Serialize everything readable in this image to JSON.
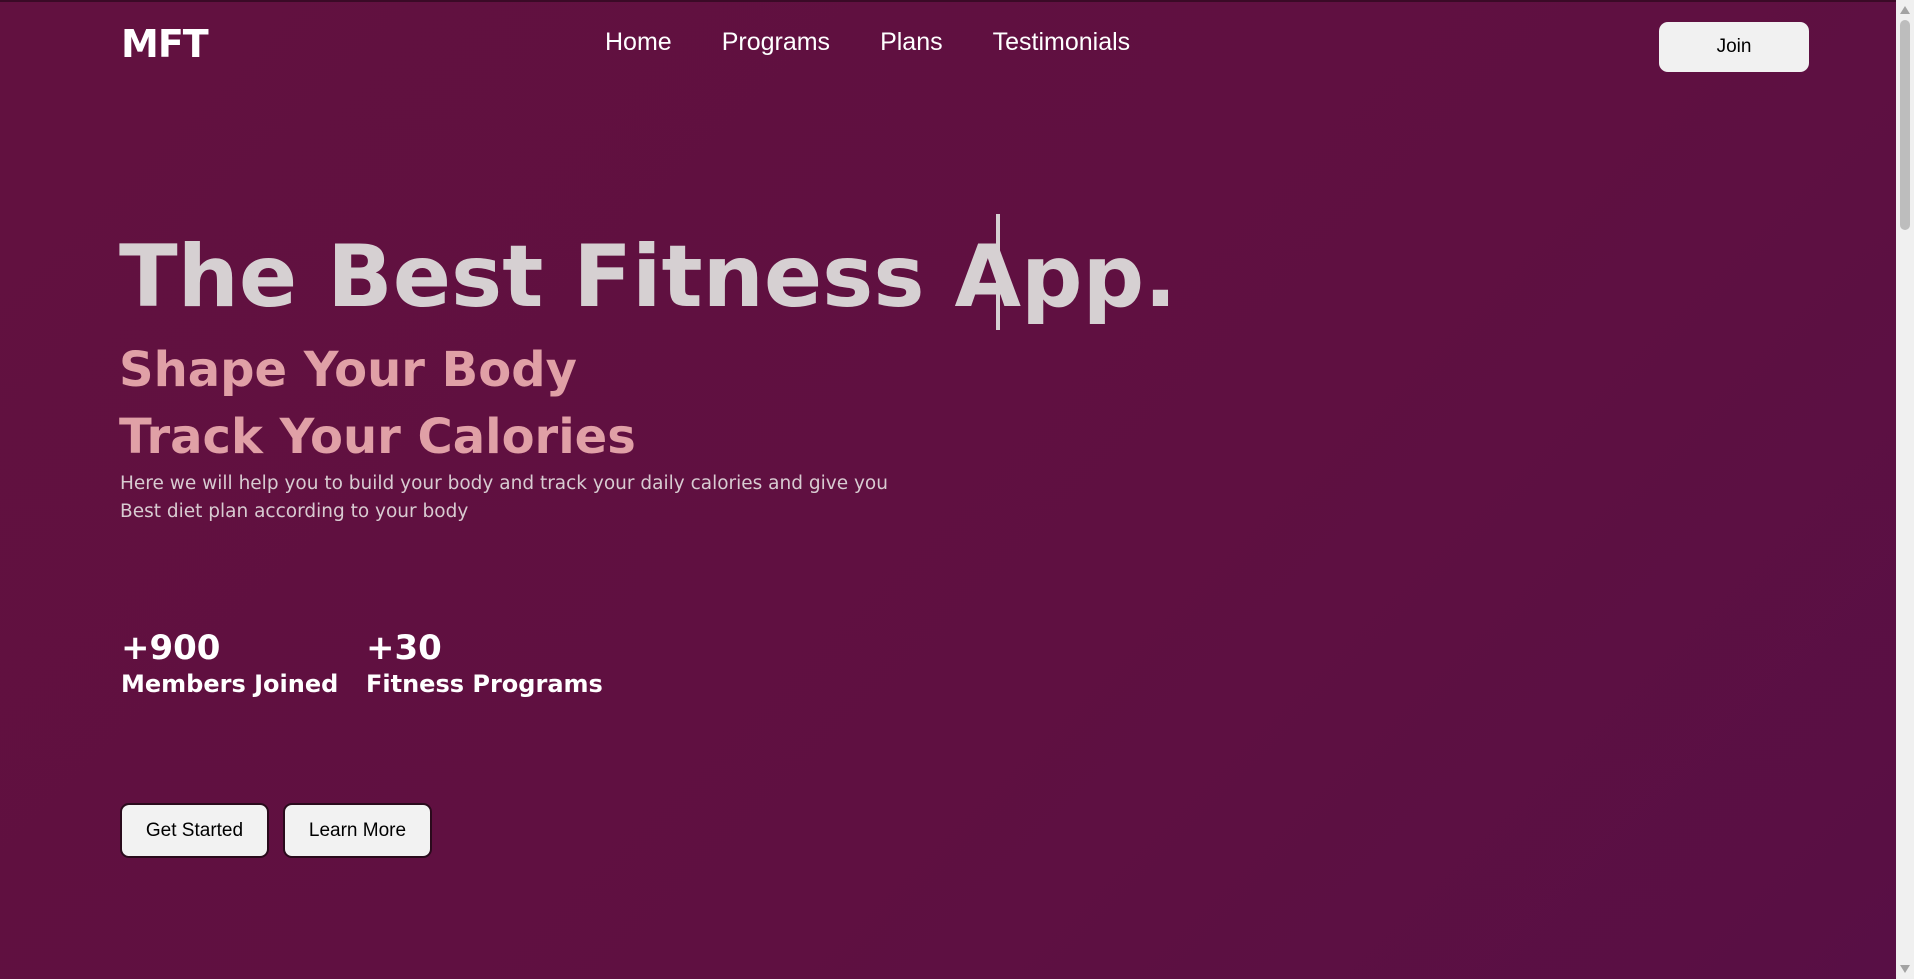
{
  "header": {
    "logo": "MFT",
    "nav": [
      "Home",
      "Programs",
      "Plans",
      "Testimonials"
    ],
    "join_label": "Join"
  },
  "hero": {
    "title": "The Best Fitness App.",
    "subtitle_1": "Shape Your Body",
    "subtitle_2": "Track Your Calories",
    "description_line_1": "Here we will help you to build your body and track your daily calories and give you",
    "description_line_2": "Best diet plan according to your body"
  },
  "stats": [
    {
      "value": "+900",
      "label": "Members Joined"
    },
    {
      "value": "+30",
      "label": "Fitness Programs"
    }
  ],
  "buttons": {
    "get_started": "Get Started",
    "learn_more": "Learn More"
  }
}
